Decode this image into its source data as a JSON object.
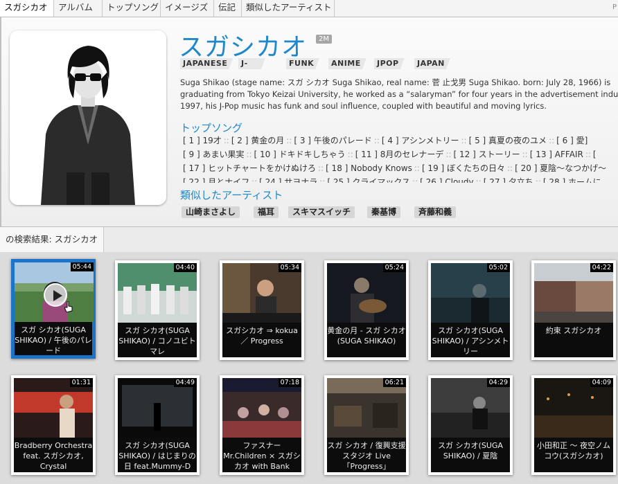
{
  "nav": {
    "tabs": [
      "スガシカオ",
      "アルバム",
      "トップソング",
      "イメージズ",
      "伝記",
      "類似したアーティスト"
    ],
    "corner": "P"
  },
  "artist": {
    "name": "スガシカオ",
    "listeners": "2M",
    "tags": [
      "JAPANESE",
      "J-POP",
      "FUNK",
      "ANIME",
      "JPOP",
      "JAPAN"
    ],
    "bio": [
      "Suga Shikao (stage name: スガ シカオ Suga Shikao, real name: 菅 止戈男 Suga Shikao. born: July 28, 1966) is",
      "graduating from Tokyo Keizai University, he worked as a “salaryman” for four years in the advertisement indu",
      "1997, his J-Pop music has funk and soul influence, coupled with beautiful and moving lyrics."
    ],
    "top_songs_title": "トップソング",
    "top_songs_rows": [
      [
        "[ 1 ] 19才",
        "[ 2 ] 黄金の月",
        "[ 3 ] 午後のパレード",
        "[ 4 ] アシンメトリー",
        "[ 5 ] 真夏の夜のユメ",
        "[ 6 ] 愛]"
      ],
      [
        "[ 9 ] あまい果実",
        "[ 10 ] ドキドキしちゃう",
        "[ 11 ] 8月のセレナーデ",
        "[ 12 ] ストーリー",
        "[ 13 ] AFFAIR",
        "["
      ],
      [
        "[ 17 ] ヒットチャートをかけぬけろ",
        "[ 18 ] Nobody Knows",
        "[ 19 ] ぼくたちの日々",
        "[ 20 ] 夏陰〜なつかげ〜"
      ],
      [
        "[ 22 ] 月とナイフ",
        "[ 24 ] サヨナラ",
        "[ 25 ] クライマックス",
        "[ 26 ] Cloudy",
        "[ 27 ] 夕立ち",
        "[ 28 ] ホームに"
      ]
    ],
    "similar_title": "類似したアーティスト",
    "similar": [
      "山崎まさよし",
      "福耳",
      "スキマスイッチ",
      "秦基博",
      "斉藤和義"
    ]
  },
  "search": {
    "label": "の検索結果: スガシカオ"
  },
  "videos": [
    {
      "title": "スガ シカオ(SUGA SHIKAO) / 午後のパレード",
      "duration": "05:44",
      "selected": true
    },
    {
      "title": "スガ シカオ(SUGA SHIKAO) / コノユビトマレ",
      "duration": "04:40"
    },
    {
      "title": "スガシカオ ⇒ kokua ／ Progress",
      "duration": "05:34"
    },
    {
      "title": "黄金の月 - スガ シカオ(SUGA SHIKAO)",
      "duration": "05:24"
    },
    {
      "title": "スガ シカオ(SUGA SHIKAO) / アシンメトリー",
      "duration": "05:02"
    },
    {
      "title": "約束 スガシカオ",
      "duration": "04:22"
    },
    {
      "title": "Bradberry Orchestra feat. スガシカオ, Crystal",
      "duration": "01:31"
    },
    {
      "title": "スガ シカオ(SUGA SHIKAO) / はじまりの日 feat.Mummy-D",
      "duration": "04:49"
    },
    {
      "title": "ファスナー Mr.Children × スガシカオ with Bank",
      "duration": "07:18"
    },
    {
      "title": "スガ シカオ / 復興支援スタジオ Live「Progress」",
      "duration": "06:21"
    },
    {
      "title": "スガ シカオ(SUGA SHIKAO) / 夏陰",
      "duration": "04:29"
    },
    {
      "title": "小田和正 ～ 夜空ノムコウ(スガシカオ)",
      "duration": "04:09"
    }
  ]
}
